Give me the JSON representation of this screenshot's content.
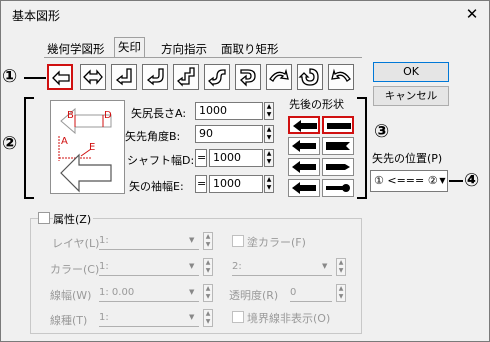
{
  "dialog": {
    "title": "基本図形",
    "close_glyph": "✕"
  },
  "tabs": [
    {
      "label": "幾何学図形"
    },
    {
      "label": "矢印"
    },
    {
      "label": "方向指示"
    },
    {
      "label": "面取り矩形"
    }
  ],
  "callouts": {
    "c1": "①",
    "c2": "②",
    "c3": "③",
    "c4": "④"
  },
  "arrow_icons": [
    "left-arrow-icon",
    "double-ended-arrow-icon",
    "bent-arrow-icon",
    "u-turn-down-icon",
    "step-arrow-icon",
    "s-curve-arrow-icon",
    "circular-return-icon",
    "curved-up-arrow-icon",
    "rotate-arrow-icon",
    "curved-left-arrow-icon"
  ],
  "preview": {
    "label_b": "B",
    "label_d": "D",
    "label_a": "A",
    "label_e": "E"
  },
  "params": [
    {
      "label": "矢尻長さA:",
      "value": "1000"
    },
    {
      "label": "矢先角度B:",
      "value": "90"
    },
    {
      "label": "シャフト幅D:",
      "prefix": "=",
      "value": "1000"
    },
    {
      "label": "矢の袖幅E:",
      "prefix": "=",
      "value": "1000"
    }
  ],
  "shape": {
    "title": "先後の形状"
  },
  "buttons": {
    "ok": "OK",
    "cancel": "キャンセル"
  },
  "position": {
    "label": "矢先の位置(P)",
    "value": "① <=== ②"
  },
  "attributes": {
    "title": "属性(Z)",
    "layer_label": "レイヤ(L)",
    "layer_value": "1:",
    "fill_label": "塗カラー(F)",
    "color_label": "カラー(C)",
    "color_value": "1:",
    "fill_value": "2:",
    "width_label": "線幅(W)",
    "width_value": "1: 0.00",
    "transparency_label": "透明度(R)",
    "transparency_value": "0",
    "type_label": "線種(T)",
    "type_value": "1:",
    "hide_border_label": "境界線非表示(O)"
  },
  "colors": {
    "highlight": "#d01010",
    "accent": "#0078d7"
  }
}
